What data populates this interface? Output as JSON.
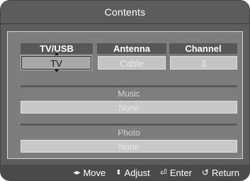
{
  "menu": {
    "title": "Contents"
  },
  "columns": [
    {
      "header": "TV/USB",
      "value": "TV",
      "selected": true
    },
    {
      "header": "Antenna",
      "value": "Cable",
      "selected": false
    },
    {
      "header": "Channel",
      "value": "3",
      "selected": false
    }
  ],
  "sections": [
    {
      "label": "Music",
      "value": "None"
    },
    {
      "label": "Photo",
      "value": "None"
    }
  ],
  "footer": {
    "move": {
      "icon": "left-right-arrows-icon",
      "label": "Move"
    },
    "adjust": {
      "icon": "up-down-arrows-icon",
      "label": "Adjust"
    },
    "enter": {
      "icon": "enter-icon",
      "label": "Enter"
    },
    "return": {
      "icon": "return-icon",
      "label": "Return"
    }
  },
  "colors": {
    "background": "#6a6a6a",
    "header_bar": "#5c5c5c",
    "selected_tile": "#a8a8a8",
    "unselected_tile": "#c4c4c4",
    "text": "#ffffff"
  }
}
